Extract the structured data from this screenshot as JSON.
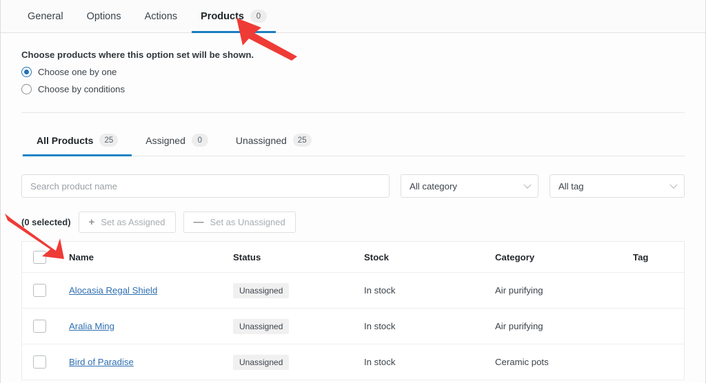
{
  "top_tabs": [
    {
      "label": "General",
      "badge": null,
      "active": false
    },
    {
      "label": "Options",
      "badge": null,
      "active": false
    },
    {
      "label": "Actions",
      "badge": null,
      "active": false
    },
    {
      "label": "Products",
      "badge": "0",
      "active": true
    }
  ],
  "instructions": {
    "heading": "Choose products where this option set will be shown.",
    "options": [
      {
        "label": "Choose one by one",
        "selected": true
      },
      {
        "label": "Choose by conditions",
        "selected": false
      }
    ]
  },
  "sub_tabs": [
    {
      "label": "All Products",
      "badge": "25",
      "active": true
    },
    {
      "label": "Assigned",
      "badge": "0",
      "active": false
    },
    {
      "label": "Unassigned",
      "badge": "25",
      "active": false
    }
  ],
  "filters": {
    "search_placeholder": "Search product name",
    "search_value": "",
    "category_select": "All category",
    "tag_select": "All tag"
  },
  "bulk_actions": {
    "selected_count": "(0 selected)",
    "set_assigned": "Set as Assigned",
    "set_unassigned": "Set as Unassigned",
    "plus_glyph": "+",
    "minus_glyph": "—"
  },
  "table": {
    "columns": [
      "Name",
      "Status",
      "Stock",
      "Category",
      "Tag"
    ],
    "rows": [
      {
        "name": "Alocasia Regal Shield",
        "status": "Unassigned",
        "stock": "In stock",
        "category": "Air purifying",
        "tag": ""
      },
      {
        "name": "Aralia Ming",
        "status": "Unassigned",
        "stock": "In stock",
        "category": "Air purifying",
        "tag": ""
      },
      {
        "name": "Bird of Paradise",
        "status": "Unassigned",
        "stock": "In stock",
        "category": "Ceramic pots",
        "tag": ""
      }
    ]
  },
  "colors": {
    "accent": "#1a7fc1",
    "link": "#2f6fb0",
    "annotation": "#ef3b36",
    "badge_bg": "#f0f0f0"
  },
  "annotations": [
    {
      "name": "arrow-to-products-tab",
      "points_to": "Products tab"
    },
    {
      "name": "arrow-to-header-checkbox",
      "points_to": "select-all checkbox"
    }
  ]
}
